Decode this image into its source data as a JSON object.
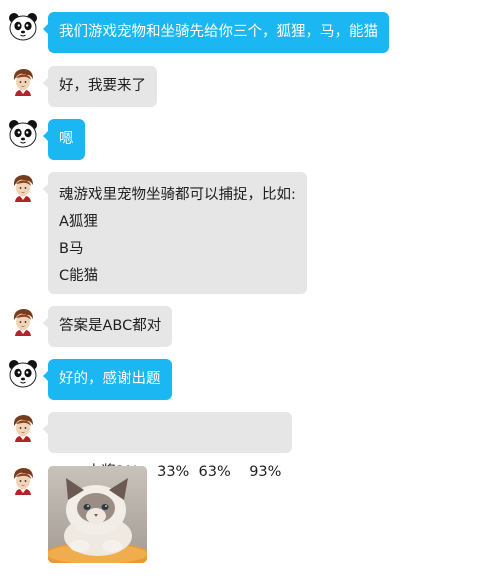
{
  "messages": [
    {
      "sender": "panda",
      "style": "blue",
      "text": "我们游戏宠物和坐骑先给你三个，狐狸，马，能猫"
    },
    {
      "sender": "user",
      "style": "gray",
      "text": "好，我要来了"
    },
    {
      "sender": "panda",
      "style": "blue",
      "text": "嗯"
    },
    {
      "sender": "user",
      "style": "gray",
      "lines": [
        "魂游戏里宠物坐骑都可以捕捉，比如:",
        "A狐狸",
        "B马",
        "C能猫"
      ]
    },
    {
      "sender": "user",
      "style": "gray",
      "text": "答案是ABC都对"
    },
    {
      "sender": "panda",
      "style": "blue",
      "text": "好的，感谢出题"
    },
    {
      "sender": "user",
      "style": "gray",
      "text": "中奖3%    33%  63%    93%"
    },
    {
      "sender": "user",
      "style": "image",
      "image": "cat-photo"
    }
  ],
  "colors": {
    "blue_bubble": "#1bb7f2",
    "gray_bubble": "#e6e6e6"
  },
  "icons": {
    "panda": "panda-avatar-icon",
    "user": "anime-character-avatar-icon"
  }
}
